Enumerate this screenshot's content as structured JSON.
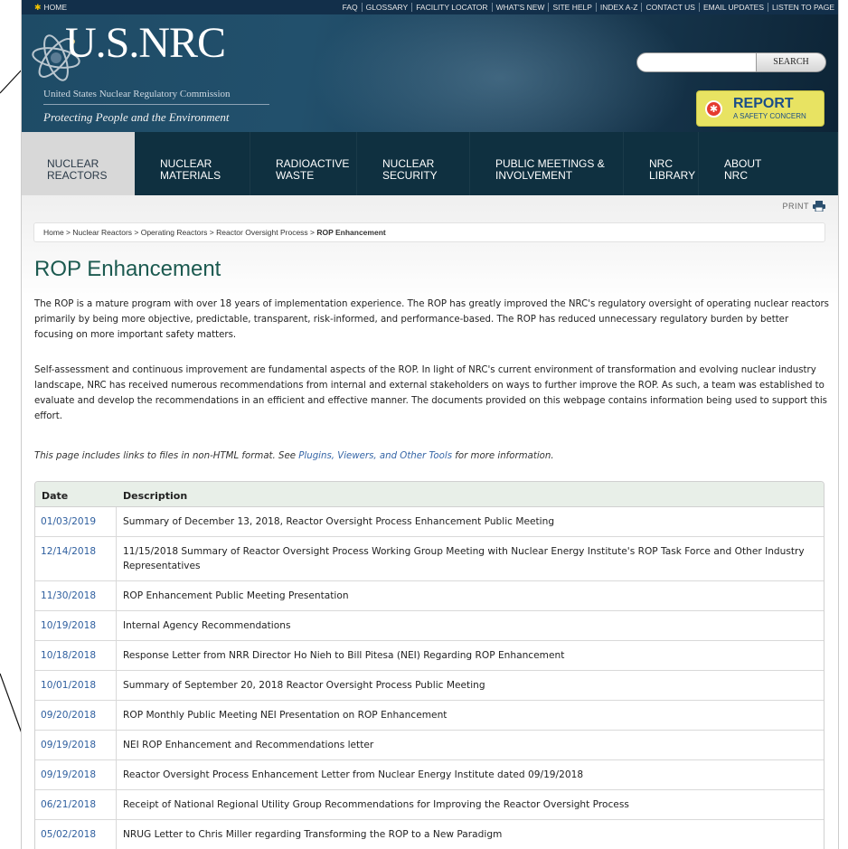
{
  "utility_bar": {
    "home": "HOME",
    "links": [
      "FAQ",
      "GLOSSARY",
      "FACILITY LOCATOR",
      "WHAT'S NEW",
      "SITE HELP",
      "INDEX A-Z",
      "CONTACT US",
      "EMAIL UPDATES",
      "LISTEN TO PAGE"
    ]
  },
  "header": {
    "logo": "U.S.NRC",
    "subtitle": "United States Nuclear Regulatory Commission",
    "tagline": "Protecting People and the Environment",
    "search_placeholder": "",
    "search_label": "SEARCH",
    "report_title": "REPORT",
    "report_sub": "A SAFETY CONCERN"
  },
  "nav": [
    "NUCLEAR\nREACTORS",
    "NUCLEAR\nMATERIALS",
    "RADIOACTIVE\nWASTE",
    "NUCLEAR\nSECURITY",
    "PUBLIC MEETINGS &\nINVOLVEMENT",
    "NRC\nLIBRARY",
    "ABOUT\nNRC"
  ],
  "print_label": "PRINT",
  "breadcrumb": {
    "path": "Home > Nuclear Reactors > Operating Reactors > Reactor Oversight Process > ",
    "current": "ROP Enhancement"
  },
  "title": "ROP Enhancement",
  "paragraphs": [
    "The ROP is a mature program with over 18 years of implementation experience.  The ROP has greatly improved the NRC's regulatory oversight of operating nuclear reactors primarily by being more objective, predictable, transparent, risk-informed, and performance-based.  The ROP has reduced unnecessary regulatory burden by better focusing on more important safety matters.",
    "Self-assessment and continuous improvement are fundamental aspects of the ROP.  In light of NRC's current environment of transformation and evolving nuclear industry landscape, NRC has received numerous recommendations from internal and external stakeholders on ways to further improve the ROP.  As such, a team was established to evaluate and develop the recommendations in an efficient and effective manner.  The documents provided on this webpage contains information being used to support this effort."
  ],
  "format_note": {
    "before": "This page includes links to files in non-HTML format. See ",
    "link": "Plugins, Viewers, and Other Tools",
    "after": " for more information."
  },
  "table": {
    "headers": [
      "Date",
      "Description"
    ],
    "rows": [
      [
        "01/03/2019",
        "Summary of December 13, 2018, Reactor Oversight Process Enhancement Public Meeting"
      ],
      [
        "12/14/2018",
        "11/15/2018 Summary of Reactor Oversight Process Working Group Meeting with Nuclear Energy Institute's ROP Task Force and Other Industry Representatives"
      ],
      [
        "11/30/2018",
        "ROP Enhancement Public Meeting Presentation"
      ],
      [
        "10/19/2018",
        "Internal Agency Recommendations"
      ],
      [
        "10/18/2018",
        "Response Letter from NRR Director Ho Nieh to Bill Pitesa (NEI) Regarding ROP Enhancement"
      ],
      [
        "10/01/2018",
        "Summary of September 20, 2018 Reactor Oversight Process Public Meeting"
      ],
      [
        "09/20/2018",
        "ROP Monthly Public Meeting NEI Presentation on ROP Enhancement"
      ],
      [
        "09/19/2018",
        "NEI ROP Enhancement and Recommendations letter"
      ],
      [
        "09/19/2018",
        "Reactor Oversight Process Enhancement Letter from Nuclear Energy Institute dated 09/19/2018"
      ],
      [
        "06/21/2018",
        "Receipt of National Regional Utility Group Recommendations for Improving the Reactor Oversight Process"
      ],
      [
        "05/02/2018",
        "NRUG Letter to Chris Miller regarding Transforming the ROP to a New Paradigm"
      ]
    ]
  },
  "colors": {
    "nav_bg": "#0f3040",
    "title": "#1c5a50",
    "link": "#2f5f9f",
    "report_bg": "#e8e362"
  }
}
